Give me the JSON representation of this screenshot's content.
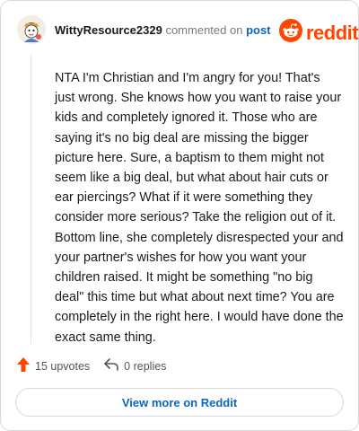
{
  "header": {
    "username": "WittyResource2329",
    "commented_on": "commented on",
    "post_link": "post",
    "brand": "reddit"
  },
  "comment": {
    "body": "NTA I'm Christian and I'm angry for you! That's just wrong. She knows how you want to raise your kids and completely ignored it. Those who are saying it's no big deal are missing the bigger picture here. Sure, a baptism to them might not seem like a big deal, but what about hair cuts or ear piercings? What if it were something they consider more serious? Take the religion out of it. Bottom line, she completely disrespected your and your partner's wishes for how you want your children raised. It might be something \"no big deal\" this time but what about next time? You are completely in the right here. I would have done the exact same thing."
  },
  "actions": {
    "upvotes_label": "15 upvotes",
    "replies_label": "0 replies"
  },
  "footer": {
    "view_more_label": "View more on Reddit"
  },
  "colors": {
    "brand": "#ff4500",
    "link": "#0a66c2",
    "border": "#d7dadc"
  },
  "icons": [
    "avatar-image",
    "reddit-snoo-icon",
    "upvote-arrow-icon",
    "reply-arrow-icon"
  ]
}
